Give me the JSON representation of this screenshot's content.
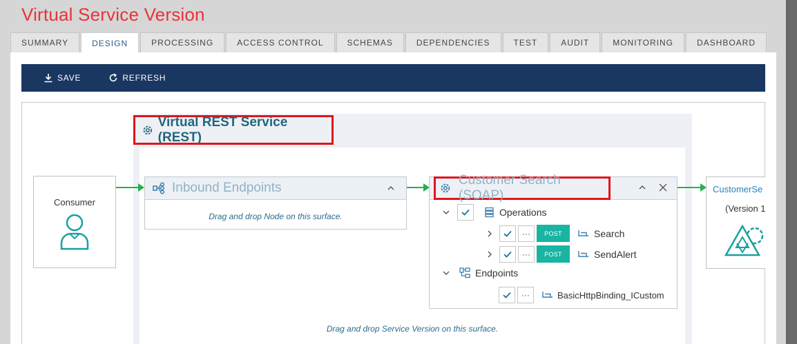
{
  "page": {
    "title": "Virtual Service Version"
  },
  "tabs": [
    {
      "label": "SUMMARY"
    },
    {
      "label": "DESIGN",
      "active": true
    },
    {
      "label": "PROCESSING"
    },
    {
      "label": "ACCESS CONTROL"
    },
    {
      "label": "SCHEMAS"
    },
    {
      "label": "DEPENDENCIES"
    },
    {
      "label": "TEST"
    },
    {
      "label": "AUDIT"
    },
    {
      "label": "MONITORING"
    },
    {
      "label": "DASHBOARD"
    }
  ],
  "toolbar": {
    "save_label": "SAVE",
    "refresh_label": "REFRESH"
  },
  "canvas": {
    "service_title": "Virtual REST Service (REST)",
    "consumer_label": "Consumer",
    "inbound": {
      "title": "Inbound Endpoints",
      "drop_text": "Drag and drop Node on this surface."
    },
    "customer_search": {
      "title": "Customer Search (SOAP)",
      "operations_label": "Operations",
      "operations": [
        {
          "method": "POST",
          "name": "Search"
        },
        {
          "method": "POST",
          "name": "SendAlert"
        }
      ],
      "endpoints_label": "Endpoints",
      "endpoint_name": "BasicHttpBinding_ICustom"
    },
    "target": {
      "name": "CustomerSe",
      "version": "(Version 1"
    },
    "service_drop_text": "Drag and drop Service Version on this surface."
  },
  "colors": {
    "title_red": "#e8333a",
    "toolbar_navy": "#193761",
    "accent_green": "#22b24c",
    "post_teal": "#19b4a2",
    "highlight_red": "#e0141b"
  }
}
